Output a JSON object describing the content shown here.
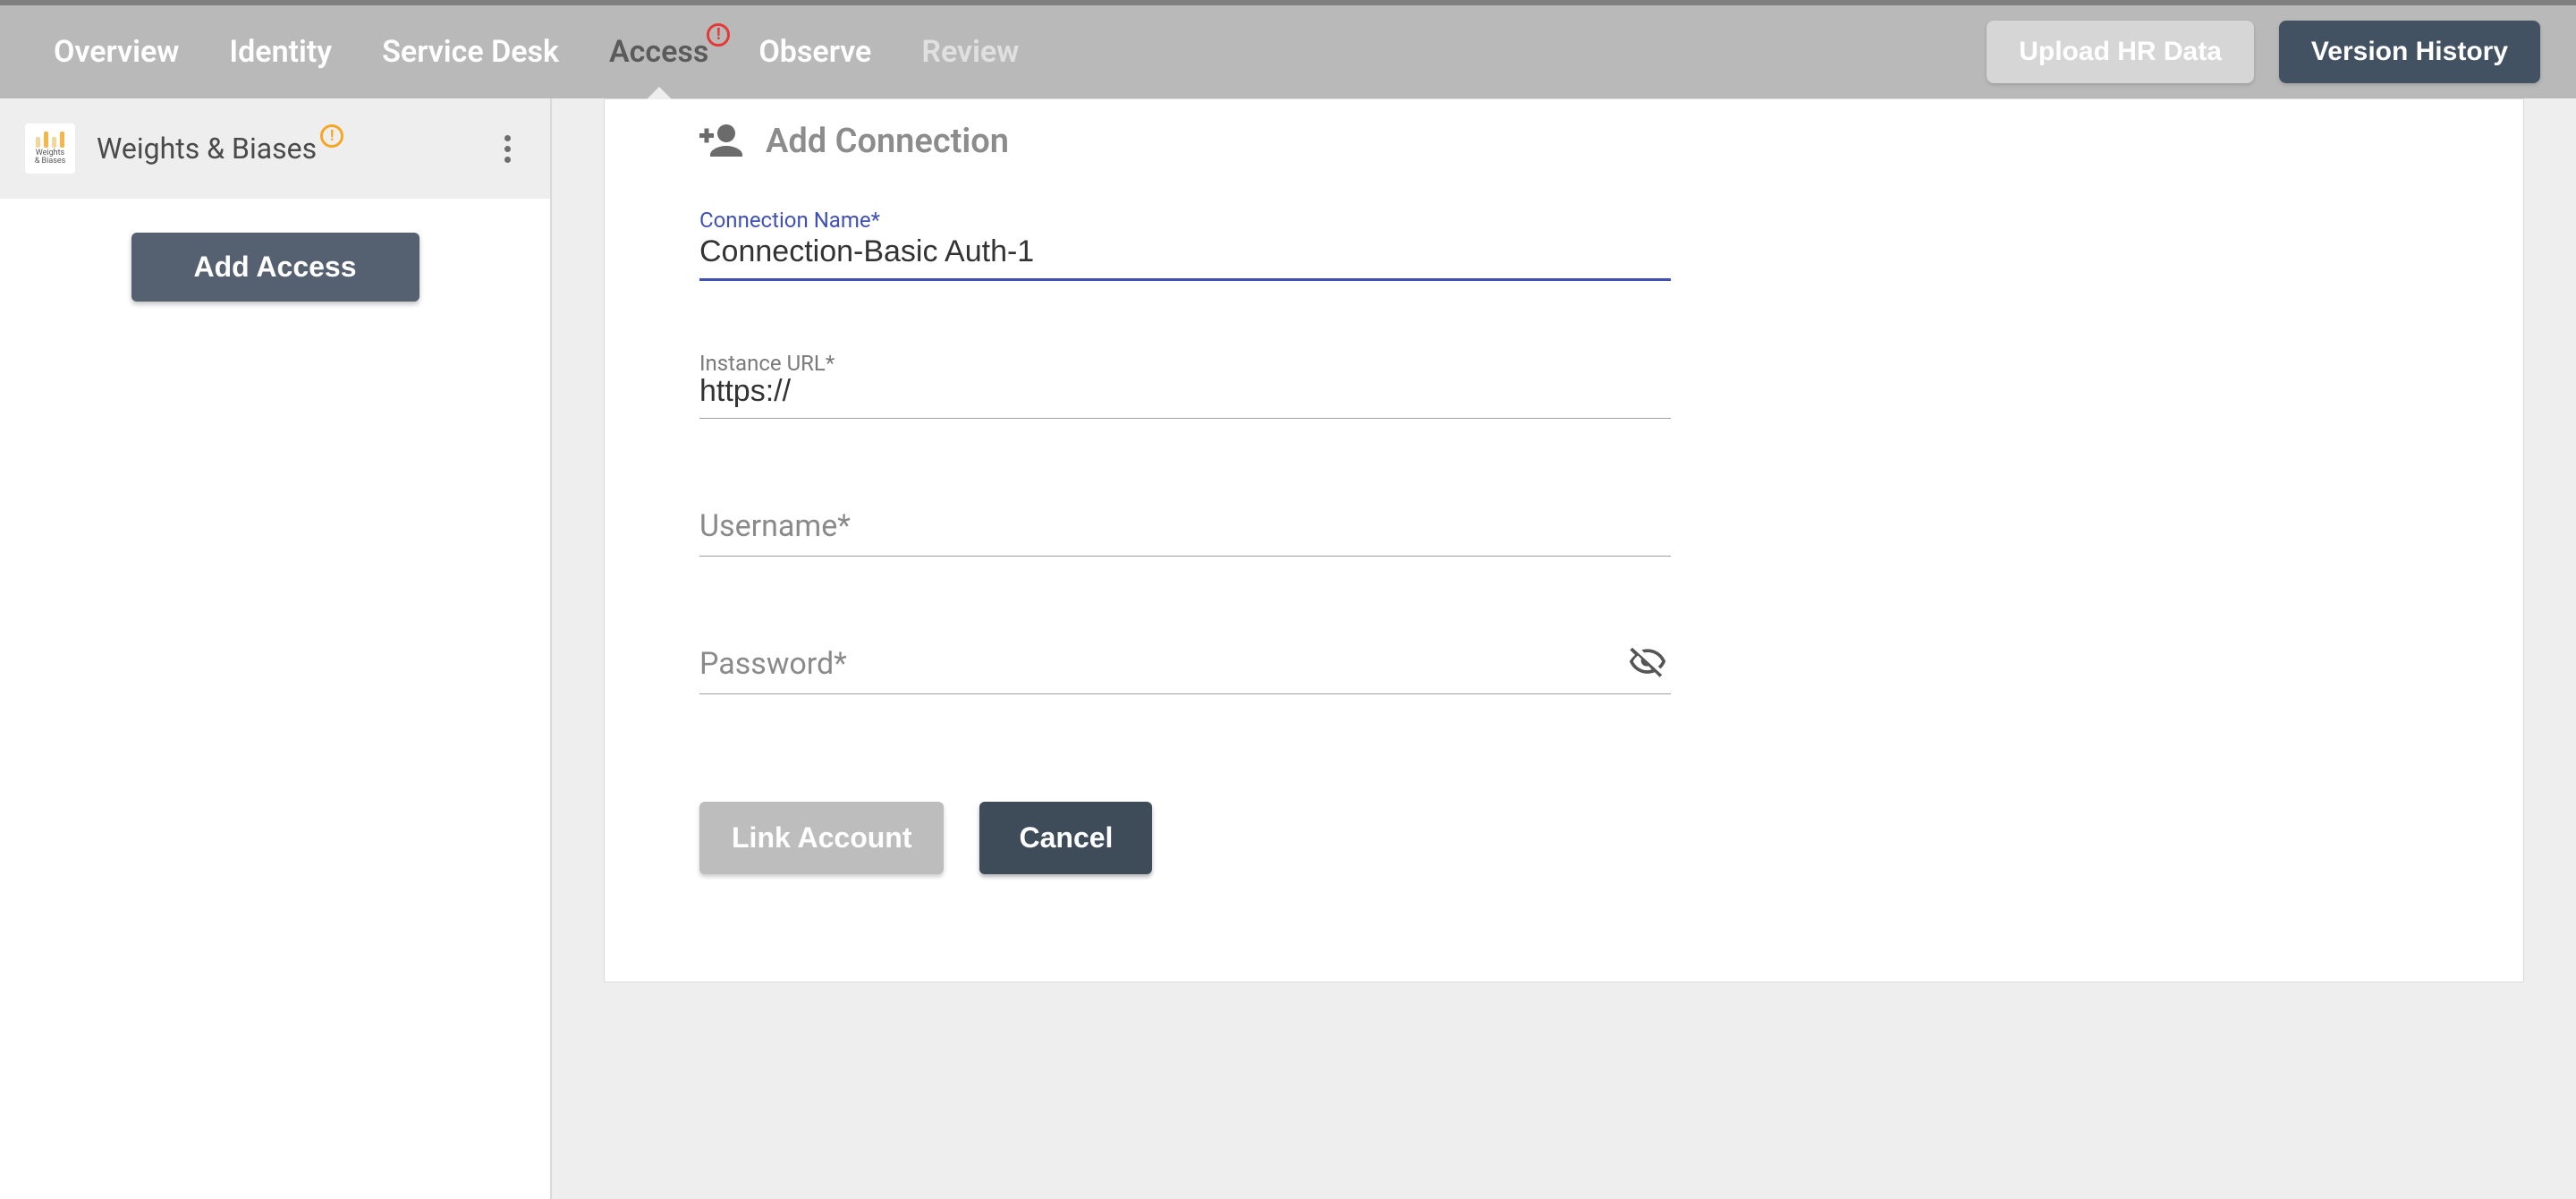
{
  "nav": {
    "tabs": [
      {
        "label": "Overview",
        "state": "normal"
      },
      {
        "label": "Identity",
        "state": "normal"
      },
      {
        "label": "Service Desk",
        "state": "normal"
      },
      {
        "label": "Access",
        "state": "active",
        "alert": true
      },
      {
        "label": "Observe",
        "state": "normal"
      },
      {
        "label": "Review",
        "state": "disabled"
      }
    ],
    "actions": {
      "upload": "Upload HR Data",
      "version": "Version History"
    }
  },
  "sidebar": {
    "item": {
      "label": "Weights & Biases",
      "logo_text": "Weights & Biases"
    },
    "add_button": "Add Access"
  },
  "form": {
    "title": "Add Connection",
    "fields": {
      "connection_name": {
        "label": "Connection Name*",
        "value": "Connection-Basic Auth-1"
      },
      "instance_url": {
        "label": "Instance URL*",
        "value": "https://"
      },
      "username": {
        "label": "Username*",
        "value": ""
      },
      "password": {
        "label": "Password*",
        "value": ""
      }
    },
    "actions": {
      "link": "Link Account",
      "cancel": "Cancel"
    }
  }
}
